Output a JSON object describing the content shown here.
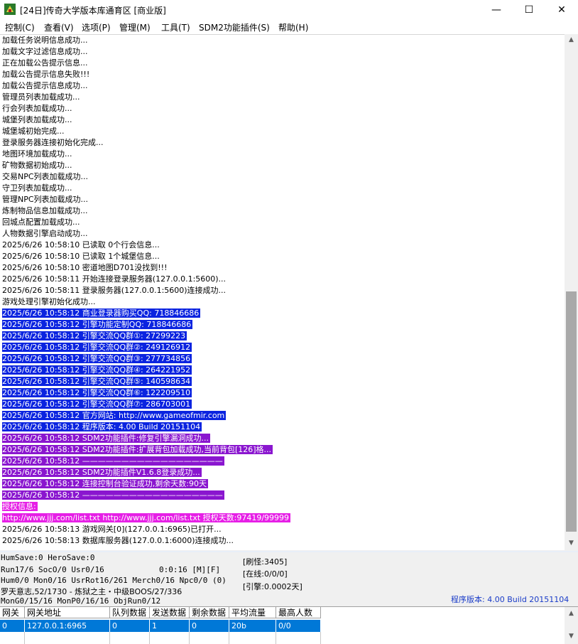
{
  "window": {
    "title": "[24日]传奇大学版本库通育区 [商业版]",
    "controls": {
      "minimize": "—",
      "maximize": "☐",
      "close": "✕"
    }
  },
  "menu": [
    "控制(C)",
    "查看(V)",
    "选项(P)",
    "管理(M)",
    "工具(T)",
    "SDM2功能插件(S)",
    "帮助(H)"
  ],
  "log": [
    {
      "text": "加载任务说明信息成功...",
      "hl": ""
    },
    {
      "text": "加载文字过滤信息成功...",
      "hl": ""
    },
    {
      "text": "正在加载公告提示信息...",
      "hl": ""
    },
    {
      "text": "加载公告提示信息失败!!!",
      "hl": ""
    },
    {
      "text": "加载公告提示信息成功...",
      "hl": ""
    },
    {
      "text": "管理员列表加载成功...",
      "hl": ""
    },
    {
      "text": "行会列表加载成功...",
      "hl": ""
    },
    {
      "text": "城堡列表加载成功...",
      "hl": ""
    },
    {
      "text": "城堡城初始完成...",
      "hl": ""
    },
    {
      "text": "登录服务器连接初始化完成...",
      "hl": ""
    },
    {
      "text": "地图环境加载成功...",
      "hl": ""
    },
    {
      "text": "矿物数据初始成功...",
      "hl": ""
    },
    {
      "text": "交易NPC列表加载成功...",
      "hl": ""
    },
    {
      "text": "守卫列表加载成功...",
      "hl": ""
    },
    {
      "text": "管理NPC列表加载成功...",
      "hl": ""
    },
    {
      "text": "炼制物品信息加载成功...",
      "hl": ""
    },
    {
      "text": "回城点配置加载成功...",
      "hl": ""
    },
    {
      "text": "人物数据引擎启动成功...",
      "hl": ""
    },
    {
      "text": "2025/6/26 10:58:10 已读取 0个行会信息...",
      "hl": ""
    },
    {
      "text": "2025/6/26 10:58:10 已读取 1个城堡信息...",
      "hl": ""
    },
    {
      "text": "2025/6/26 10:58:10 密道地图D701没找到!!!",
      "hl": ""
    },
    {
      "text": "2025/6/26 10:58:11 开始连接登录服务器(127.0.0.1:5600)...",
      "hl": ""
    },
    {
      "text": "2025/6/26 10:58:11 登录服务器(127.0.0.1:5600)连接成功...",
      "hl": ""
    },
    {
      "text": "游戏处理引擎初始化成功...",
      "hl": ""
    },
    {
      "text": "2025/6/26 10:58:12 商业登录器购买QQ: 718846686",
      "hl": "blue"
    },
    {
      "text": "2025/6/26 10:58:12 引擎功能定制QQ: 718846686",
      "hl": "blue"
    },
    {
      "text": "2025/6/26 10:58:12 引擎交流QQ群①: 27299223",
      "hl": "blue"
    },
    {
      "text": "2025/6/26 10:58:12 引擎交流QQ群②: 249126912",
      "hl": "blue"
    },
    {
      "text": "2025/6/26 10:58:12 引擎交流QQ群③: 277734856",
      "hl": "blue"
    },
    {
      "text": "2025/6/26 10:58:12 引擎交流QQ群④: 264221952",
      "hl": "blue"
    },
    {
      "text": "2025/6/26 10:58:12 引擎交流QQ群⑤: 140598634",
      "hl": "blue"
    },
    {
      "text": "2025/6/26 10:58:12 引擎交流QQ群⑥: 122209510",
      "hl": "blue"
    },
    {
      "text": "2025/6/26 10:58:12 引擎交流QQ群⑦: 286703001",
      "hl": "blue"
    },
    {
      "text": "2025/6/26 10:58:12 官方网站: http://www.gameofmir.com",
      "hl": "blue"
    },
    {
      "text": "2025/6/26 10:58:12 程序版本: 4.00 Build 20151104",
      "hl": "blue"
    },
    {
      "text": "2025/6/26 10:58:12 SDM2功能插件:修复引擎漏洞成功...",
      "hl": "purple"
    },
    {
      "text": "2025/6/26 10:58:12 SDM2功能插件:扩展背包加载成功,当前背包[126]格...",
      "hl": "purple"
    },
    {
      "text": "2025/6/26 10:58:12 ——————————————————",
      "hl": "purple"
    },
    {
      "text": "2025/6/26 10:58:12 SDM2功能插件V1.6.8登录成功...",
      "hl": "purple"
    },
    {
      "text": "2025/6/26 10:58:12 连接控制台验证成功,剩余天数:90天",
      "hl": "purple"
    },
    {
      "text": "2025/6/26 10:58:12 ——————————————————",
      "hl": "purple"
    },
    {
      "text": "授权信息:",
      "hl": "magenta"
    },
    {
      "text": "http://www.jjj.com/list.txt http://www.jjj.com/list.txt 授权天数:97419/99999",
      "hl": "magenta"
    },
    {
      "text": "2025/6/26 10:58:13 游戏网关[0](127.0.0.1:6965)已打开...",
      "hl": ""
    },
    {
      "text": "2025/6/26 10:58:13 数据库服务器(127.0.0.1:6000)连接成功...",
      "hl": ""
    }
  ],
  "status": {
    "line1": "HumSave:0 HeroSave:0",
    "line2a": "Run17/6 SocO/0 Usr0/16",
    "line2b": "0:0:16 [M][F]",
    "line3": "Hum0/0 Mon0/16 UsrRot16/261 Merch0/16 Npc0/0 (0)",
    "line4": "罗天意志,52/1730 - 炼狱之主・中级BOOS/27/336",
    "line5": "MonG0/15/16 MonP0/16/16 ObjRun0/12",
    "refresh_mon": "[刷怪:3405]",
    "online": "[在线:0/0/0]",
    "engine": "[引擎:0.0002天]",
    "version": "程序版本: 4.00 Build 20151104"
  },
  "gate_table": {
    "headers": [
      "网关",
      "网关地址",
      "队列数据",
      "发送数据",
      "剩余数据",
      "平均流量",
      "最高人数"
    ],
    "rows": [
      [
        "0",
        "127.0.0.1:6965",
        "0",
        "1",
        "0",
        "20b",
        "0/0"
      ]
    ]
  },
  "colors": {
    "blue": "#0b24e0",
    "purple": "#8a16cf",
    "magenta": "#e61fe6",
    "version_text": "#1a3cc8"
  }
}
